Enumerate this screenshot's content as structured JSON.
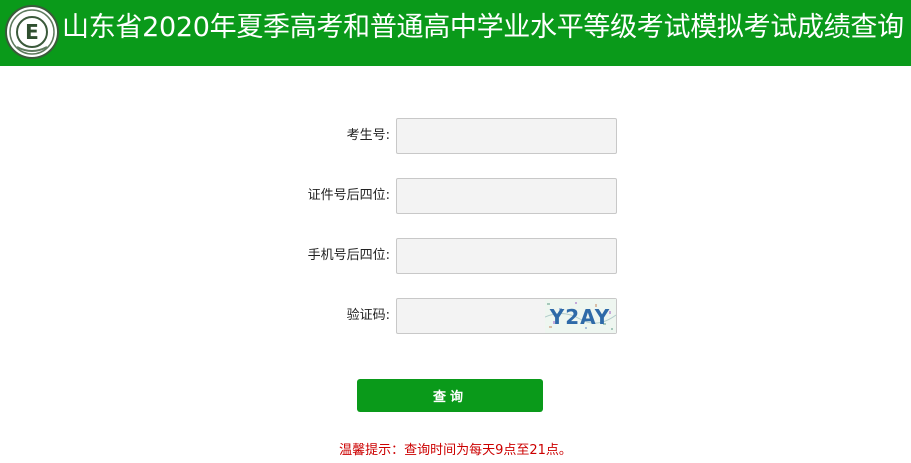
{
  "header": {
    "title": "山东省2020年夏季高考和普通高中学业水平等级考试模拟考试成绩查询",
    "background_color": "#0a9a1a",
    "logo_icon": "exam-authority-logo",
    "logo_letter": "E"
  },
  "form": {
    "fields": [
      {
        "label": "考生号:",
        "value": "",
        "placeholder": ""
      },
      {
        "label": "证件号后四位:",
        "value": "",
        "placeholder": ""
      },
      {
        "label": "手机号后四位:",
        "value": "",
        "placeholder": ""
      },
      {
        "label": "验证码:",
        "value": "",
        "placeholder": ""
      }
    ],
    "captcha_text": "Y2AY",
    "submit_label": "查询",
    "button_color": "#0a9a1a"
  },
  "hint": {
    "text": "温馨提示：查询时间为每天9点至21点。",
    "color": "#cc0000"
  }
}
